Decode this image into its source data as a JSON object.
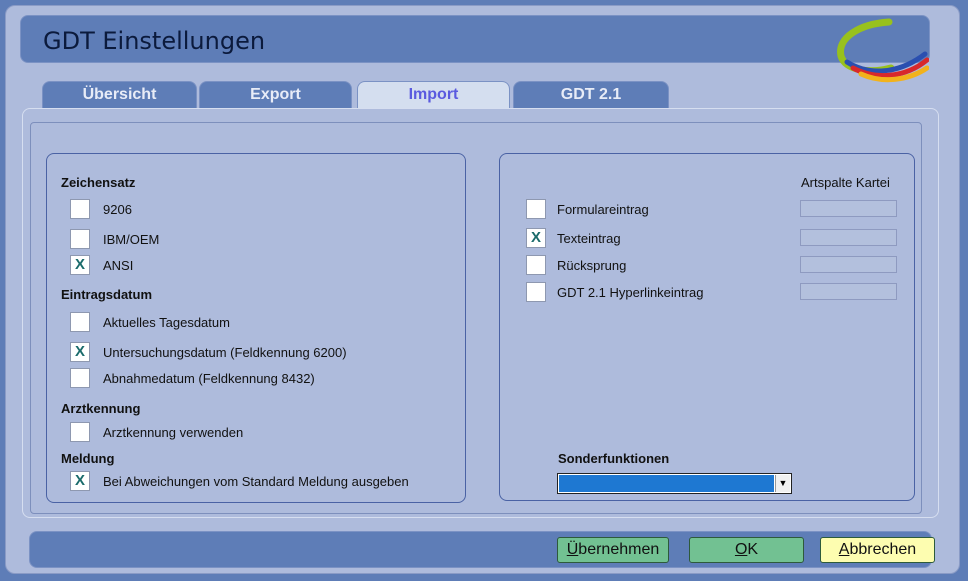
{
  "window": {
    "title": "GDT Einstellungen"
  },
  "tabs": [
    {
      "label": "Übersicht",
      "active": false
    },
    {
      "label": "Export",
      "active": false
    },
    {
      "label": "Import",
      "active": true
    },
    {
      "label": "GDT 2.1",
      "active": false
    }
  ],
  "left": {
    "zeichensatz": {
      "title": "Zeichensatz",
      "options": [
        {
          "label": "9206",
          "mark": ""
        },
        {
          "label": "IBM/OEM",
          "mark": ""
        },
        {
          "label": "ANSI",
          "mark": "X"
        }
      ]
    },
    "eintragsdatum": {
      "title": "Eintragsdatum",
      "options": [
        {
          "label": "Aktuelles Tagesdatum",
          "mark": ""
        },
        {
          "label": "Untersuchungsdatum (Feldkennung 6200)",
          "mark": "X"
        },
        {
          "label": "Abnahmedatum (Feldkennung 8432)",
          "mark": ""
        }
      ]
    },
    "arztkennung": {
      "title": "Arztkennung",
      "options": [
        {
          "label": "Arztkennung verwenden",
          "mark": ""
        }
      ]
    },
    "meldung": {
      "title": "Meldung",
      "options": [
        {
          "label": "Bei Abweichungen vom Standard Meldung ausgeben",
          "mark": "X"
        }
      ]
    }
  },
  "right": {
    "column_header": "Artspalte Kartei",
    "options": [
      {
        "label": "Formulareintrag",
        "mark": "",
        "artspalte": ""
      },
      {
        "label": "Texteintrag",
        "mark": "X",
        "artspalte": ""
      },
      {
        "label": "Rücksprung",
        "mark": "",
        "artspalte": ""
      },
      {
        "label": "GDT 2.1 Hyperlinkeintrag",
        "mark": "",
        "artspalte": ""
      }
    ],
    "sonderfunktionen": {
      "label": "Sonderfunktionen",
      "value": ""
    }
  },
  "footer": {
    "apply": {
      "first": "Ü",
      "rest": "bernehmen"
    },
    "ok": {
      "first": "O",
      "rest": "K"
    },
    "cancel": {
      "first": "A",
      "rest": "bbrechen"
    }
  },
  "colors": {
    "background": "#5e7db7",
    "panel": "#aebbdc",
    "active_tab_text": "#5a5adf",
    "check_mark": "#1a6b6b",
    "green_button": "#72c192",
    "yellow_button": "#fdfdb0",
    "select_fill": "#1e78d2"
  }
}
